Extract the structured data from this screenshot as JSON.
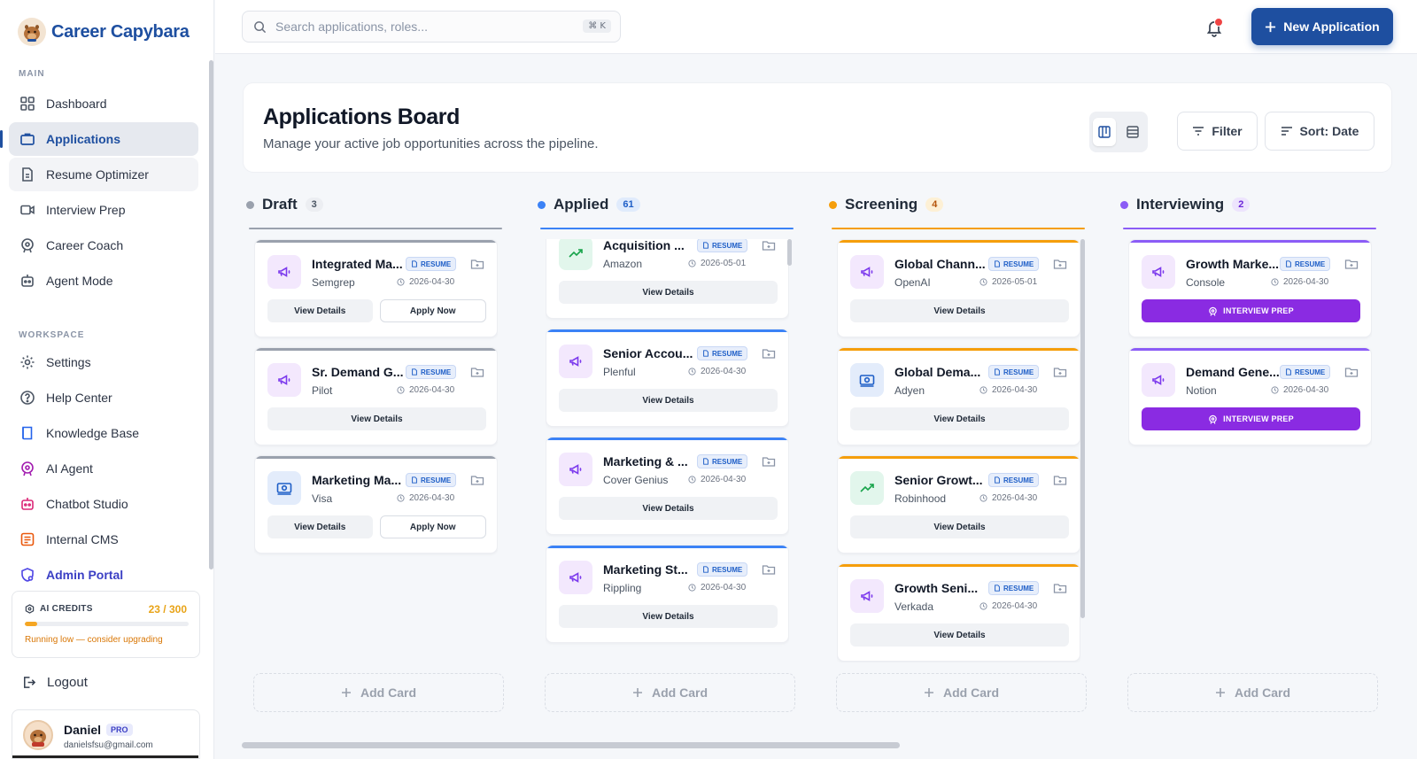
{
  "brand": {
    "name": "Career Capybara"
  },
  "sidebar": {
    "main_label": "MAIN",
    "main_items": [
      {
        "label": "Dashboard",
        "icon": "grid-icon"
      },
      {
        "label": "Applications",
        "icon": "briefcase-icon"
      },
      {
        "label": "Resume Optimizer",
        "icon": "document-icon"
      },
      {
        "label": "Interview Prep",
        "icon": "video-icon"
      },
      {
        "label": "Career Coach",
        "icon": "coach-icon"
      },
      {
        "label": "Agent Mode",
        "icon": "robot-icon"
      }
    ],
    "workspace_label": "WORKSPACE",
    "workspace_items": [
      {
        "label": "Settings",
        "icon": "gear-icon"
      },
      {
        "label": "Help Center",
        "icon": "help-icon"
      },
      {
        "label": "Knowledge Base",
        "icon": "book-icon"
      },
      {
        "label": "AI Agent",
        "icon": "ai-agent-icon"
      },
      {
        "label": "Chatbot Studio",
        "icon": "chatbot-icon"
      },
      {
        "label": "Internal CMS",
        "icon": "cms-icon"
      },
      {
        "label": "Admin Portal",
        "icon": "admin-icon"
      }
    ],
    "credits": {
      "label": "AI CREDITS",
      "value": "23 / 300",
      "used": 23,
      "total": 300,
      "warning": "Running low — consider upgrading"
    },
    "logout_label": "Logout",
    "user": {
      "name": "Daniel",
      "badge": "PRO",
      "email": "danielsfsu@gmail.com"
    }
  },
  "topbar": {
    "search_placeholder": "Search applications, roles...",
    "shortcut": "⌘ K",
    "new_application_label": "New Application"
  },
  "header": {
    "title": "Applications Board",
    "subtitle": "Manage your active job opportunities across the pipeline.",
    "filter_label": "Filter",
    "sort_label": "Sort: Date"
  },
  "colors": {
    "brand": "#1e4fa0",
    "draft": "#9aa1ad",
    "applied": "#3b82f6",
    "screening": "#f59e0b",
    "interviewing": "#8b5cf6",
    "interview_prep": "#8a2be2"
  },
  "board": {
    "add_card_label": "Add Card",
    "columns": [
      {
        "title": "Draft",
        "count": "3",
        "cards": [
          {
            "title": "Integrated Ma...",
            "company": "Semgrep",
            "date": "2026-04-30",
            "badge": "RESUME",
            "view": "View Details",
            "apply": "Apply Now",
            "icon": "megaphone-icon"
          },
          {
            "title": "Sr. Demand G...",
            "company": "Pilot",
            "date": "2026-04-30",
            "badge": "RESUME",
            "view": "View Details",
            "icon": "megaphone-icon"
          },
          {
            "title": "Marketing Ma...",
            "company": "Visa",
            "date": "2026-04-30",
            "badge": "RESUME",
            "view": "View Details",
            "apply": "Apply Now",
            "icon": "money-icon"
          }
        ]
      },
      {
        "title": "Applied",
        "count": "61",
        "cards": [
          {
            "title": "Acquisition ...",
            "company": "Amazon",
            "date": "2026-05-01",
            "badge": "RESUME",
            "view": "View Details",
            "icon": "trend-icon"
          },
          {
            "title": "Senior Accou...",
            "company": "Plenful",
            "date": "2026-04-30",
            "badge": "RESUME",
            "view": "View Details",
            "icon": "megaphone-icon"
          },
          {
            "title": "Marketing & ...",
            "company": "Cover Genius",
            "date": "2026-04-30",
            "badge": "RESUME",
            "view": "View Details",
            "icon": "megaphone-icon"
          },
          {
            "title": "Marketing St...",
            "company": "Rippling",
            "date": "2026-04-30",
            "badge": "RESUME",
            "view": "View Details",
            "icon": "megaphone-icon"
          }
        ]
      },
      {
        "title": "Screening",
        "count": "4",
        "cards": [
          {
            "title": "Global Chann...",
            "company": "OpenAI",
            "date": "2026-05-01",
            "badge": "RESUME",
            "view": "View Details",
            "icon": "megaphone-icon"
          },
          {
            "title": "Global Dema...",
            "company": "Adyen",
            "date": "2026-04-30",
            "badge": "RESUME",
            "view": "View Details",
            "icon": "money-icon"
          },
          {
            "title": "Senior Growt...",
            "company": "Robinhood",
            "date": "2026-04-30",
            "badge": "RESUME",
            "view": "View Details",
            "icon": "trend-icon"
          },
          {
            "title": "Growth Seni...",
            "company": "Verkada",
            "date": "2026-04-30",
            "badge": "RESUME",
            "view": "View Details",
            "icon": "megaphone-icon"
          }
        ]
      },
      {
        "title": "Interviewing",
        "count": "2",
        "cards": [
          {
            "title": "Growth Marke...",
            "company": "Console",
            "date": "2026-04-30",
            "badge": "RESUME",
            "prep": "INTERVIEW PREP",
            "icon": "megaphone-icon"
          },
          {
            "title": "Demand Gene...",
            "company": "Notion",
            "date": "2026-04-30",
            "badge": "RESUME",
            "prep": "INTERVIEW PREP",
            "icon": "megaphone-icon"
          }
        ]
      }
    ]
  }
}
